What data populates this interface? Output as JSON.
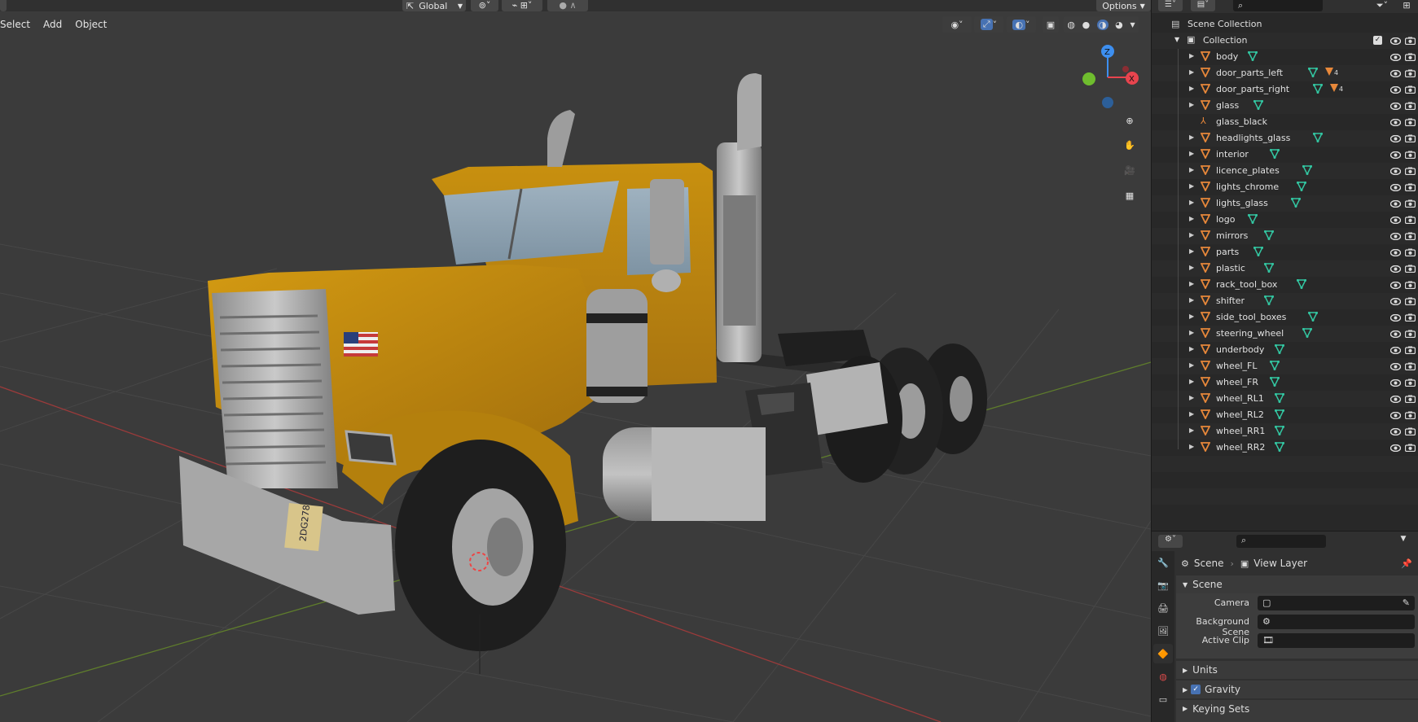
{
  "viewport_topbar": {
    "transform_orientation": "Global",
    "options_label": "Options"
  },
  "viewport_header": {
    "menus": [
      "Select",
      "Add",
      "Object"
    ]
  },
  "license_plate": "2DG278",
  "outliner": {
    "scene_collection": "Scene Collection",
    "collection": "Collection",
    "objects": [
      {
        "name": "body",
        "badge": ""
      },
      {
        "name": "door_parts_left",
        "badge": "4"
      },
      {
        "name": "door_parts_right",
        "badge": "4"
      },
      {
        "name": "glass",
        "badge": ""
      },
      {
        "name": "glass_black",
        "badge": ""
      },
      {
        "name": "headlights_glass",
        "badge": ""
      },
      {
        "name": "interior",
        "badge": ""
      },
      {
        "name": "licence_plates",
        "badge": ""
      },
      {
        "name": "lights_chrome",
        "badge": ""
      },
      {
        "name": "lights_glass",
        "badge": ""
      },
      {
        "name": "logo",
        "badge": ""
      },
      {
        "name": "mirrors",
        "badge": ""
      },
      {
        "name": "parts",
        "badge": ""
      },
      {
        "name": "plastic",
        "badge": ""
      },
      {
        "name": "rack_tool_box",
        "badge": ""
      },
      {
        "name": "shifter",
        "badge": ""
      },
      {
        "name": "side_tool_boxes",
        "badge": ""
      },
      {
        "name": "steering_wheel",
        "badge": ""
      },
      {
        "name": "underbody",
        "badge": ""
      },
      {
        "name": "wheel_FL",
        "badge": ""
      },
      {
        "name": "wheel_FR",
        "badge": ""
      },
      {
        "name": "wheel_RL1",
        "badge": ""
      },
      {
        "name": "wheel_RL2",
        "badge": ""
      },
      {
        "name": "wheel_RR1",
        "badge": ""
      },
      {
        "name": "wheel_RR2",
        "badge": ""
      }
    ]
  },
  "properties": {
    "breadcrumb_scene": "Scene",
    "breadcrumb_view_layer": "View Layer",
    "panel_scene": "Scene",
    "camera_label": "Camera",
    "background_scene_label": "Background Scene",
    "active_clip_label": "Active Clip",
    "units_label": "Units",
    "gravity_label": "Gravity",
    "keying_sets_label": "Keying Sets"
  },
  "colors": {
    "accent_blue": "#4772b3",
    "mesh_orange": "#e8883a",
    "modifier_teal": "#33c7a2",
    "axis_x": "#e8444e",
    "axis_y": "#6fbd2e",
    "axis_z": "#3d8ff0"
  }
}
